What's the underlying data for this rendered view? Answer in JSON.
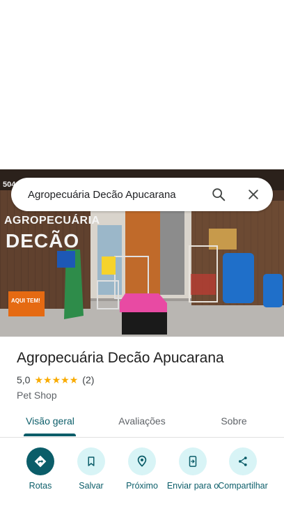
{
  "search": {
    "query": "Agropecuária Decão Apucarana"
  },
  "photo": {
    "sign_line1": "AGROPECUÁRIA",
    "sign_line2": "DECÃO",
    "banner_text": "AQUI TEM!",
    "number_text": "504",
    "brand_color": "#f5f5f5"
  },
  "place": {
    "name": "Agropecuária Decão Apucarana",
    "rating": "5,0",
    "stars": 5,
    "reviews": "(2)",
    "category": "Pet Shop"
  },
  "tabs": [
    {
      "label": "Visão geral",
      "active": true
    },
    {
      "label": "Avaliações",
      "active": false
    },
    {
      "label": "Sobre",
      "active": false
    }
  ],
  "actions": [
    {
      "label": "Rotas",
      "icon": "directions-icon"
    },
    {
      "label": "Salvar",
      "icon": "bookmark-icon"
    },
    {
      "label": "Próximo",
      "icon": "nearby-icon"
    },
    {
      "label": "Enviar para o",
      "icon": "send-to-phone-icon"
    },
    {
      "label": "Compartilhar",
      "icon": "share-icon"
    }
  ],
  "colors": {
    "accent": "#0b5d69",
    "action_bg": "#d8f4f6",
    "star": "#f9ab00"
  }
}
